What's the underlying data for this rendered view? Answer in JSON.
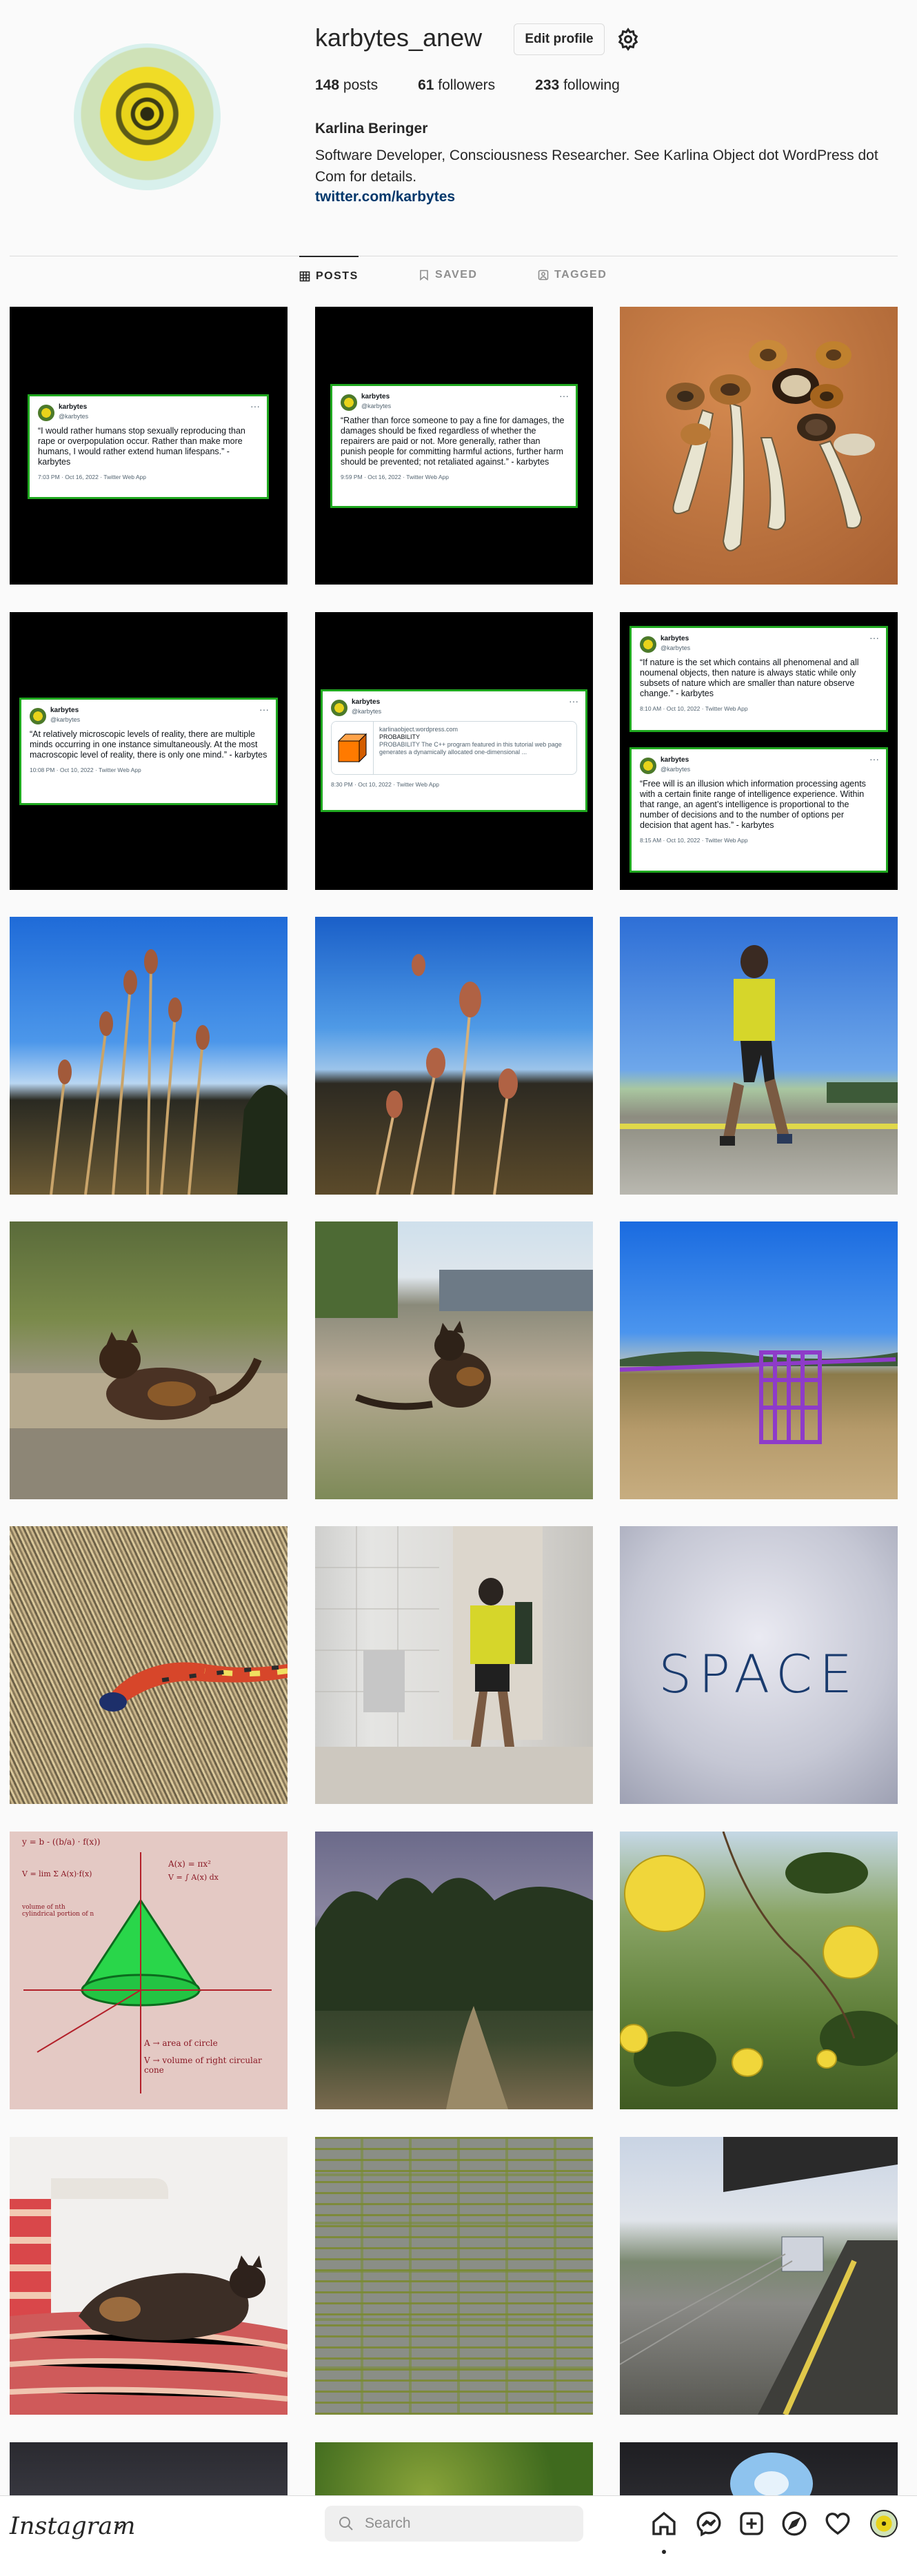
{
  "profile": {
    "username": "karbytes_anew",
    "edit_label": "Edit profile",
    "posts_count": "148",
    "posts_label": "posts",
    "followers_count": "61",
    "followers_label": "followers",
    "following_count": "233",
    "following_label": "following",
    "full_name": "Karlina Beringer",
    "bio": "Software Developer, Consciousness Researcher. See Karlina Object dot WordPress dot Com for details.",
    "link": "twitter.com/karbytes"
  },
  "tabs": [
    {
      "label": "POSTS",
      "icon": "grid-icon"
    },
    {
      "label": "SAVED",
      "icon": "bookmark-icon"
    },
    {
      "label": "TAGGED",
      "icon": "tagged-icon"
    }
  ],
  "tweets": {
    "handle_name": "karbytes",
    "handle_at": "@karbytes",
    "t1": {
      "text": "“I would rather humans stop sexually reproducing than rape or overpopulation occur. Rather than make more humans, I would rather extend human lifespans.” - karbytes",
      "footer": "7:03 PM · Oct 16, 2022 · Twitter Web App"
    },
    "t2": {
      "text": "“Rather than force someone to pay a fine for damages, the damages should be fixed regardless of whether the repairers are paid or not. More generally, rather than punish people for committing harmful actions, further harm should be prevented; not retaliated against.” - karbytes",
      "footer": "9:59 PM · Oct 16, 2022 · Twitter Web App"
    },
    "t3": {
      "text": "“At relatively microscopic levels of reality, there are multiple minds occurring in one instance simultaneously. At the most macroscopic level of reality, there is only one mind.” - karbytes",
      "footer": "10:08 PM · Oct 10, 2022 · Twitter Web App"
    },
    "t4": {
      "link_domain": "karlinaobject.wordpress.com",
      "link_title": "PROBABILITY",
      "link_desc": "PROBABILITY The C++ program featured in this tutorial web page generates a dynamically allocated one-dimensional ...",
      "footer": "8:30 PM · Oct 10, 2022 · Twitter Web App"
    },
    "t5": {
      "text": "“If nature is the set which contains all phenomenal and all noumenal objects, then nature is always static while only subsets of nature which are smaller than nature observe change.” - karbytes",
      "footer": "8:10 AM · Oct 10, 2022 · Twitter Web App"
    },
    "t6": {
      "text": "“Free will is an illusion which information processing agents with a certain finite range of intelligence experience. Within that range, an agent’s intelligence is proportional to the number of decisions and to the number of options per decision that agent has.” - karbytes",
      "footer": "8:15 AM · Oct 10, 2022 · Twitter Web App"
    }
  },
  "posts": {
    "space_word": "SPACE",
    "math_formula": "y = b - ((b/a) · f(x))",
    "math_area": "A(x) = πx²",
    "math_volume_sum": "V = lim Σ A(x)·f(x)",
    "math_volume_int": "V = ∫ A(x) dx",
    "math_note": "volume of nth cylindrical portion of n",
    "math_legend_a": "A → area of circle",
    "math_legend_v": "V → volume of right circular cone"
  },
  "bottom_nav": {
    "logo": "Instagram",
    "search_placeholder": "Search"
  },
  "colors": {
    "link": "#00376b",
    "tweet_border": "#1fa81f",
    "border": "#dbdbdb"
  }
}
